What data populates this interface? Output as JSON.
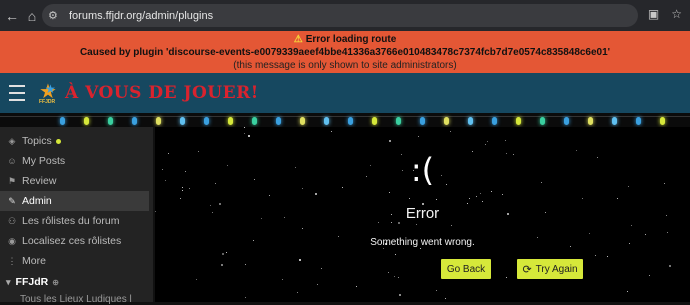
{
  "browser": {
    "url": "forums.ffjdr.org/admin/plugins",
    "back_icon": "arrow-left-icon",
    "home_icon": "home-icon"
  },
  "error_banner": {
    "title": "Error loading route",
    "detail": "Caused by plugin 'discourse-events-e0079339aeef4bbe41336a3766e010483478c7374fcb7d7e0574c835848c6e01'",
    "note": "(this message is only shown to site administrators)",
    "color": "#e45735"
  },
  "header": {
    "site_name": "À VOUS DE JOUER!",
    "logo_text": "FFJDR",
    "brand_color": "#d9232e",
    "bar_color": "#164860"
  },
  "sidebar": {
    "items": [
      {
        "label": "Topics",
        "icon": "layers-icon"
      },
      {
        "label": "My Posts",
        "icon": "user-icon"
      },
      {
        "label": "Review",
        "icon": "flag-icon"
      },
      {
        "label": "Admin",
        "icon": "wrench-icon"
      },
      {
        "label": "Les rôlistes du forum",
        "icon": "users-icon"
      },
      {
        "label": "Localisez ces rôlistes",
        "icon": "map-pin-icon"
      },
      {
        "label": "More",
        "icon": "more-icon"
      }
    ],
    "section_title": "FFJdR",
    "partial_item": "Tous les Lieux Ludiques l"
  },
  "error_page": {
    "face": ":(",
    "title": "Error",
    "message": "Something went wrong.",
    "back_label": "Go Back",
    "retry_label": "Try Again",
    "button_color": "#d6e83a"
  }
}
